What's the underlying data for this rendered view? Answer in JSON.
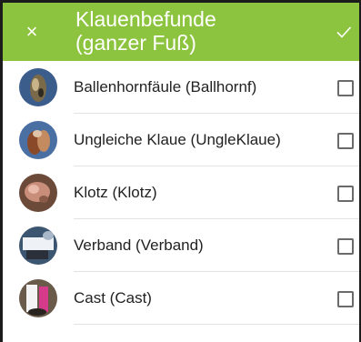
{
  "header": {
    "close_icon": "×",
    "title": "Klauenbefunde\n(ganzer Fuß)",
    "confirm_icon": "checkmark-icon",
    "color": "#8dc43f"
  },
  "items": [
    {
      "label": "Ballenhornfäule (Ballhornf)",
      "checked": false
    },
    {
      "label": "Ungleiche Klaue (UngleKlaue)",
      "checked": false
    },
    {
      "label": "Klotz (Klotz)",
      "checked": false
    },
    {
      "label": "Verband (Verband)",
      "checked": false
    },
    {
      "label": "Cast (Cast)",
      "checked": false
    }
  ]
}
